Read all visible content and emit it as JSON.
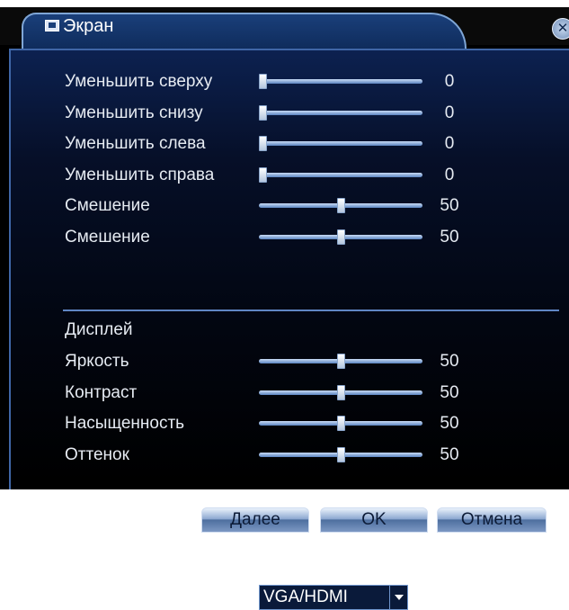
{
  "window": {
    "title": "Экран",
    "title_icon": "monitor-icon",
    "close_icon": "close-icon",
    "close_glyph": "✕"
  },
  "sliders_top": [
    {
      "label": "Уменьшить сверху",
      "value": "0",
      "level": 0
    },
    {
      "label": "Уменьшить снизу",
      "value": "0",
      "level": 0
    },
    {
      "label": "Уменьшить слева",
      "value": "0",
      "level": 0
    },
    {
      "label": "Уменьшить справа",
      "value": "0",
      "level": 0
    },
    {
      "label": "Смешение",
      "value": "50",
      "level": 0.5
    },
    {
      "label": "Смешение",
      "value": "50",
      "level": 0.5
    }
  ],
  "display": {
    "label": "Дисплей",
    "selected": "VGA/HDMI"
  },
  "sliders_bottom": [
    {
      "label": "Яркость",
      "value": "50",
      "level": 0.5
    },
    {
      "label": "Контраст",
      "value": "50",
      "level": 0.5
    },
    {
      "label": "Насыщенность",
      "value": "50",
      "level": 0.5
    },
    {
      "label": "Оттенок",
      "value": "50",
      "level": 0.5
    }
  ],
  "buttons": {
    "next": "Далее",
    "ok": "OK",
    "cancel": "Отмена"
  },
  "colors": {
    "accent": "#3f66a6",
    "panel": "#0c2150",
    "text": "#e6ebf2"
  }
}
